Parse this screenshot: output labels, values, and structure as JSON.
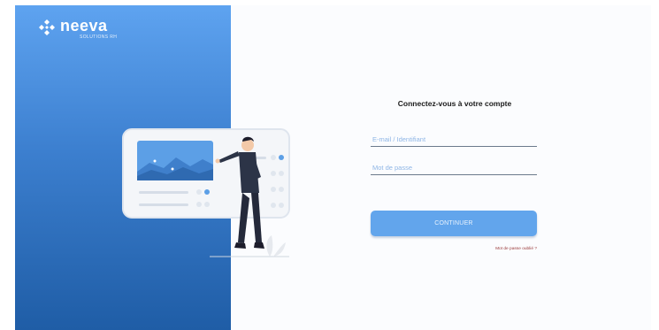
{
  "brand": {
    "name": "neeva",
    "subtitle": "SOLUTIONS RH"
  },
  "login": {
    "title": "Connectez-vous à votre compte",
    "email_placeholder": "E-mail / Identifiant",
    "password_placeholder": "Mot de passe",
    "continue_label": "CONTINUER",
    "forgot_label": "Mot de passe oublié ?"
  },
  "colors": {
    "panel_top": "#5ea3f0",
    "panel_bottom": "#1f5da6",
    "button": "#62a5ec",
    "link": "#9a3a3a"
  },
  "icons": {
    "logo": "neeva-diamond-logo-icon",
    "illustration": "person-presenting-chart-illustration"
  }
}
